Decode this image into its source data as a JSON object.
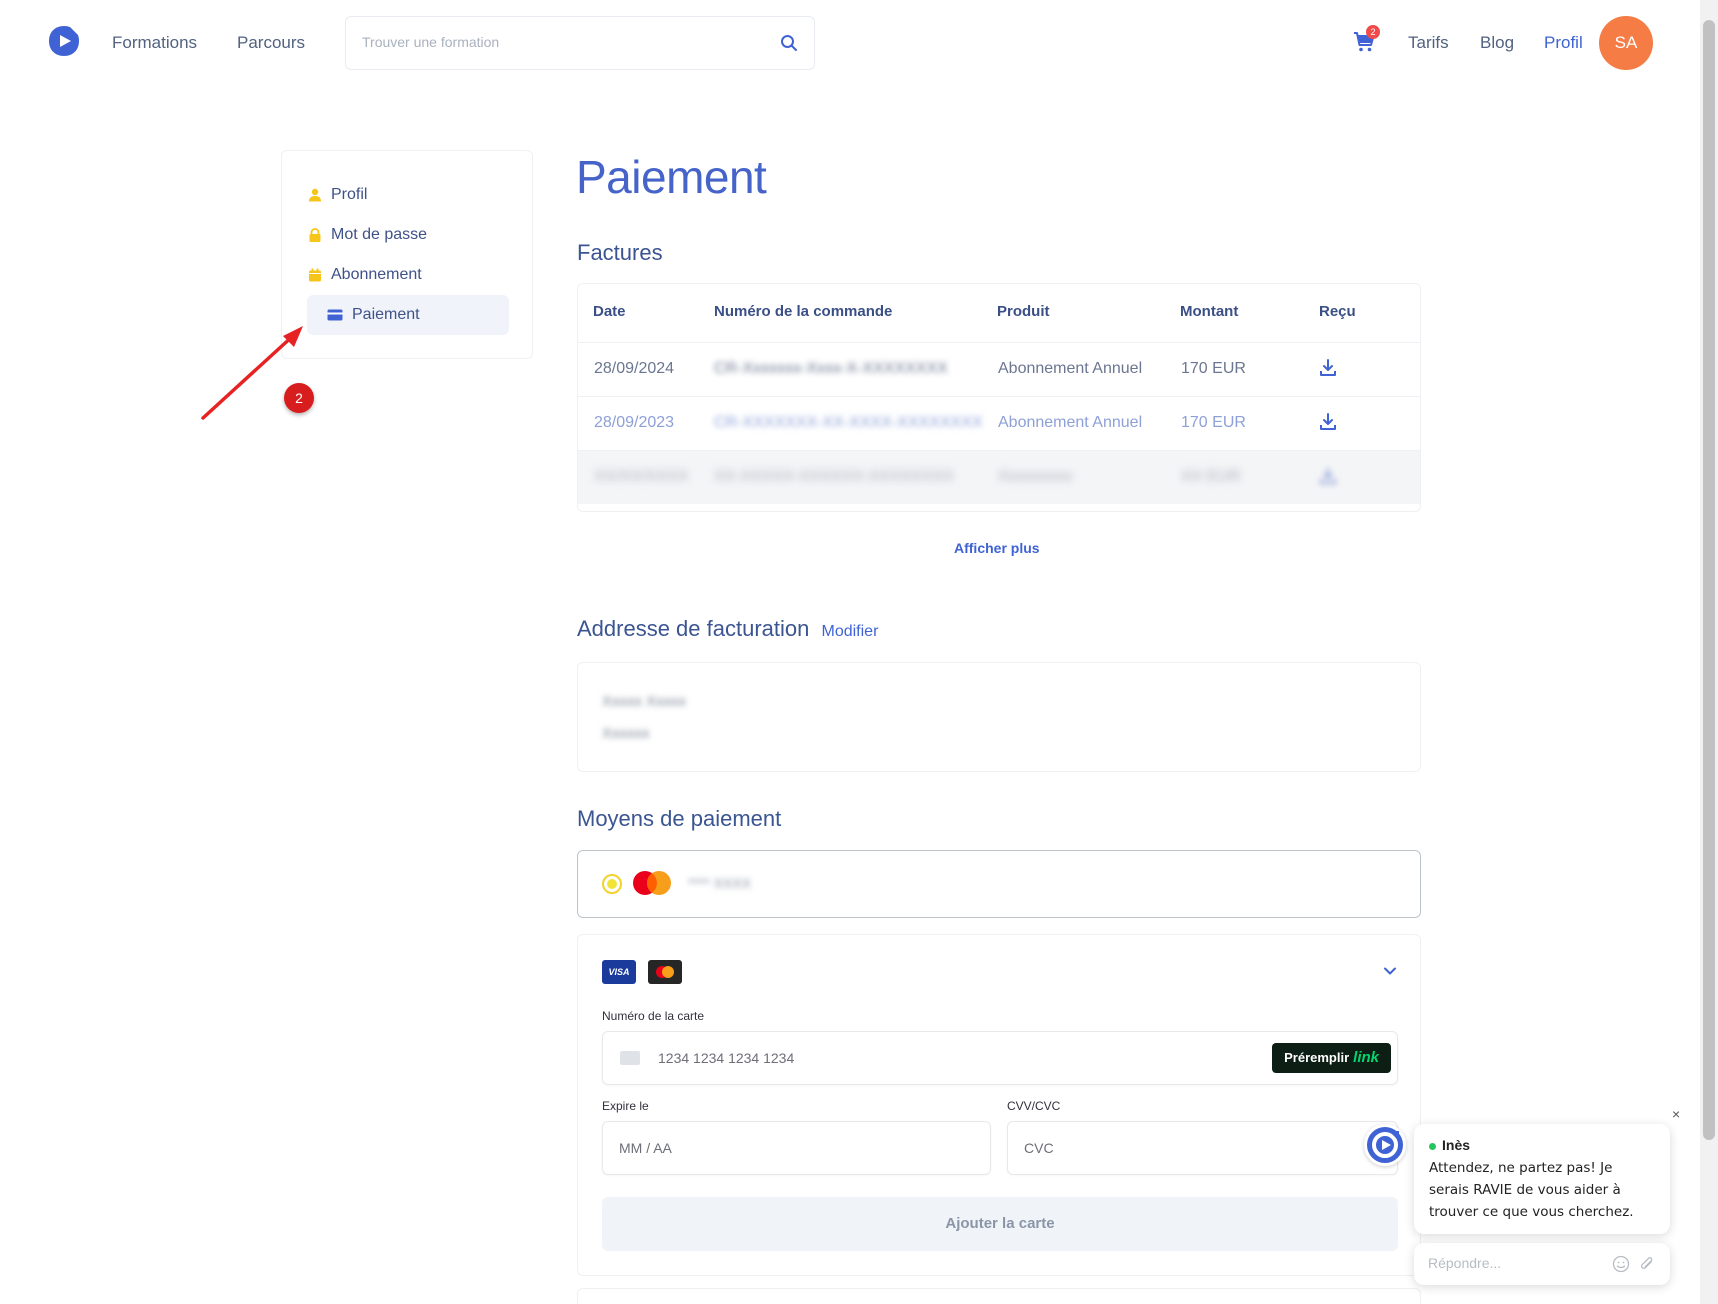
{
  "header": {
    "nav": [
      "Formations",
      "Parcours"
    ],
    "search_placeholder": "Trouver une formation",
    "cart_count": "2",
    "right_links": [
      "Tarifs",
      "Blog",
      "Profil"
    ],
    "avatar_initials": "SA"
  },
  "sidebar": {
    "items": [
      {
        "label": "Profil",
        "icon": "user-icon"
      },
      {
        "label": "Mot de passe",
        "icon": "lock-icon"
      },
      {
        "label": "Abonnement",
        "icon": "calendar-icon"
      },
      {
        "label": "Paiement",
        "icon": "credit-card-icon",
        "active": true
      }
    ]
  },
  "annotation": {
    "step": "2"
  },
  "page": {
    "title": "Paiement",
    "invoices_title": "Factures",
    "billing_title": "Addresse de facturation",
    "billing_modify": "Modifier",
    "payment_methods_title": "Moyens de paiement",
    "show_more": "Afficher plus"
  },
  "invoices": {
    "columns": [
      "Date",
      "Numéro de la commande",
      "Produit",
      "Montant",
      "Reçu"
    ],
    "rows": [
      {
        "date": "28/09/2024",
        "order": "CR-Xxxxxxx-Xxxx-X-XXXXXXXX",
        "product": "Abonnement Annuel",
        "amount": "170 EUR"
      },
      {
        "date": "28/09/2023",
        "order": "CR-XXXXXXX-XX-XXXX-XXXXXXXX",
        "product": "Abonnement Annuel",
        "amount": "170 EUR"
      },
      {
        "date": "XX/XX/XXXX",
        "order": "XX-XXXXX-XXXXXX-XXXXXXXX",
        "product": "Xxxxxxxxx",
        "amount": "XX EUR"
      }
    ]
  },
  "billing_address": {
    "name": "Xxxxx Xxxxx",
    "country": "Xxxxxx"
  },
  "saved_card": {
    "masked": "**** XXXX"
  },
  "card_form": {
    "card_number_label": "Numéro de la carte",
    "card_number_placeholder": "1234 1234 1234 1234",
    "prefill_label": "Préremplir",
    "link_label": "link",
    "expiry_label": "Expire le",
    "expiry_placeholder": "MM / AA",
    "cvc_label": "CVV/CVC",
    "cvc_placeholder": "CVC",
    "submit_label": "Ajouter la carte",
    "visa_label": "VISA"
  },
  "chat": {
    "agent_name": "Inès",
    "message": "Attendez, ne partez pas! Je serais RAVIE de vous aider à trouver ce que vous cherchez.",
    "reply_placeholder": "Répondre...",
    "close": "×"
  },
  "colors": {
    "primary": "#3f63d4",
    "title": "#4563c9",
    "avatar": "#f57c45",
    "sidebar_icons": "#f5c518",
    "annotation": "#d71d1d"
  }
}
